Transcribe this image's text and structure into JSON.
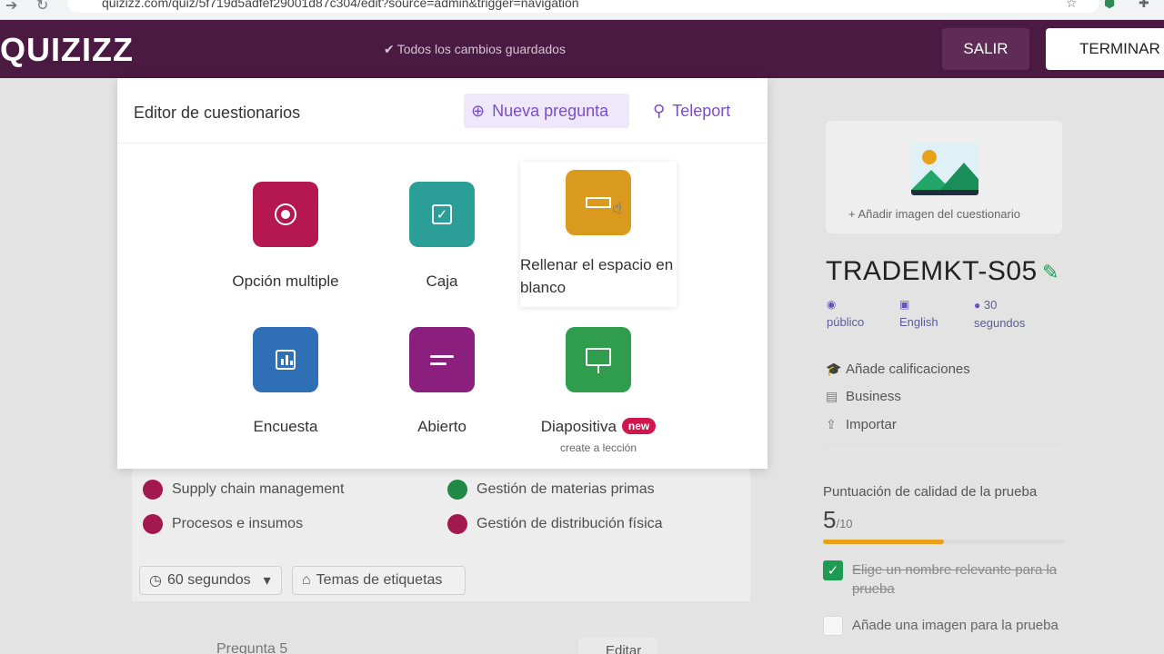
{
  "browser": {
    "url": "quizizz.com/quiz/5f719d5adfef29001d87c304/edit?source=admin&trigger=navigation",
    "back_icon": "arrow-right-icon",
    "reload_icon": "reload-icon",
    "bookmark_icon": "star-icon"
  },
  "topbar": {
    "logo": "QUIZIZZ",
    "saved_status": "Todos los cambios guardados",
    "exit_label": "SALIR",
    "finish_label": "TERMINAR"
  },
  "modal": {
    "title": "Editor de cuestionarios",
    "new_question_label": "Nueva pregunta",
    "teleport_label": "Teleport",
    "options": [
      {
        "label": "Opción multiple",
        "color": "#b5174f",
        "icon": "radio-icon"
      },
      {
        "label": "Caja",
        "color": "#2a9e97",
        "icon": "checkbox-icon"
      },
      {
        "label": "Rellenar el espacio en blanco",
        "color": "#d99a1d",
        "icon": "blank-input-icon"
      },
      {
        "label": "Encuesta",
        "color": "#2f6fb5",
        "icon": "poll-icon"
      },
      {
        "label": "Abierto",
        "color": "#8b1f7e",
        "icon": "open-text-icon"
      },
      {
        "label": "Diapositiva",
        "badge": "new",
        "note": "create a lección",
        "color": "#2f9c4e",
        "icon": "slide-icon"
      }
    ]
  },
  "background": {
    "tags": [
      {
        "label": "Supply chain management",
        "color": "#a3194f"
      },
      {
        "label": "Gestión de materias primas",
        "color": "#1e8a45"
      },
      {
        "label": "Procesos e insumos",
        "color": "#a3194f"
      },
      {
        "label": "Gestión de distribución física",
        "color": "#a3194f"
      }
    ],
    "time_label": "60 segundos",
    "tags_button_label": "Temas de etiquetas",
    "next_question_label": "Pregunta 5",
    "edit_label": "Editar"
  },
  "sidebar": {
    "add_image_label": "+ Añadir imagen del cuestionario",
    "quiz_title": "TRADEMKT-S05",
    "visibility": "público",
    "language": "English",
    "duration": "30 segundos",
    "links": [
      "Añade calificaciones",
      "Business",
      "Importar"
    ],
    "quality_label": "Puntuación de calidad de la prueba",
    "quality_score": "5",
    "quality_max": "/10",
    "quality_fraction": 0.5,
    "checklist": [
      {
        "label": "Elige un nombre relevante para la prueba",
        "done": true
      },
      {
        "label": "Añade una imagen para la prueba",
        "done": false
      }
    ]
  },
  "colors": {
    "topbar": "#4a1a43",
    "accent": "#7b4fc4",
    "new_badge": "#d0164c"
  }
}
